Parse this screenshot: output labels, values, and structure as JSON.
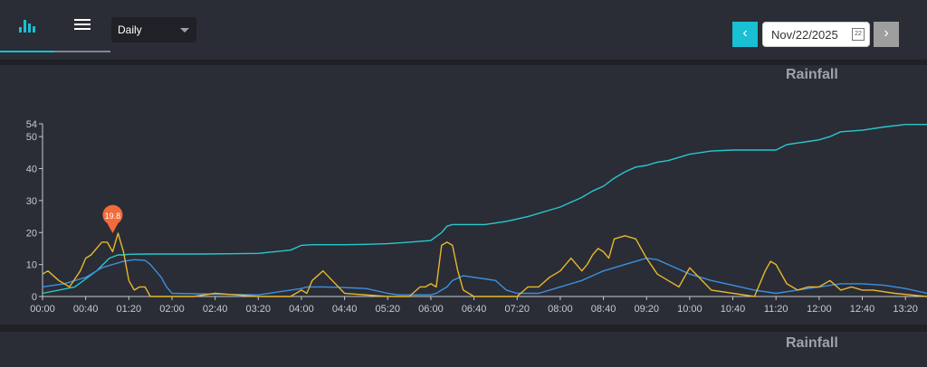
{
  "toolbar": {
    "chart_tab_icon": "bar-chart-icon",
    "list_tab_icon": "menu-icon",
    "period_select": "Daily",
    "prev_label": "‹",
    "date": "Nov/22/2025",
    "calendar_day": "22",
    "next_label": "›"
  },
  "panels": [
    {
      "title": "Rainfall"
    },
    {
      "title": "Rainfall"
    }
  ],
  "colors": {
    "accent": "#19bfd3",
    "cumulative": "#29c7cf",
    "blue": "#3d8fe0",
    "yellow": "#e7b62e",
    "marker": "#f26b3a"
  },
  "chart_data": {
    "type": "line",
    "title": "Rainfall",
    "ylim": [
      0,
      54
    ],
    "yticks": [
      0,
      10,
      20,
      30,
      40,
      50,
      54
    ],
    "xlim": [
      0,
      820
    ],
    "xticks": [
      "00:00",
      "00:40",
      "01:20",
      "02:00",
      "02:40",
      "03:20",
      "04:00",
      "04:40",
      "05:20",
      "06:00",
      "06:40",
      "07:20",
      "08:00",
      "08:40",
      "09:20",
      "10:00",
      "10:40",
      "11:20",
      "12:00",
      "12:40",
      "13:20"
    ],
    "x_tick_minutes": [
      0,
      40,
      80,
      120,
      160,
      200,
      240,
      280,
      320,
      360,
      400,
      440,
      480,
      520,
      560,
      600,
      640,
      680,
      720,
      760,
      800
    ],
    "marker": {
      "x_minutes": 65,
      "y": 19.8,
      "label": "19.8"
    },
    "series": [
      {
        "color": "#29c7cf",
        "x_minutes": [
          0,
          30,
          50,
          62,
          70,
          75,
          80,
          100,
          150,
          200,
          230,
          240,
          250,
          260,
          280,
          300,
          320,
          340,
          360,
          370,
          375,
          380,
          390,
          400,
          410,
          430,
          450,
          470,
          480,
          500,
          510,
          520,
          530,
          540,
          550,
          560,
          570,
          580,
          600,
          620,
          640,
          660,
          680,
          690,
          700,
          710,
          720,
          730,
          740,
          760,
          780,
          800,
          820
        ],
        "values": [
          1,
          3,
          8,
          12,
          13,
          13,
          13.2,
          13.3,
          13.3,
          13.5,
          14.5,
          16,
          16.2,
          16.2,
          16.2,
          16.3,
          16.5,
          17,
          17.5,
          20,
          22,
          22.5,
          22.5,
          22.5,
          22.5,
          23.5,
          25,
          27,
          28,
          31,
          33,
          34.5,
          37,
          39,
          40.5,
          41,
          42,
          42.5,
          44.5,
          45.5,
          45.8,
          45.8,
          45.8,
          47.5,
          48,
          48.5,
          49,
          50,
          51.5,
          52,
          53,
          53.8,
          53.8
        ]
      },
      {
        "color": "#3d8fe0",
        "x_minutes": [
          0,
          20,
          40,
          55,
          65,
          75,
          85,
          95,
          100,
          110,
          115,
          120,
          200,
          220,
          230,
          240,
          245,
          260,
          280,
          300,
          320,
          330,
          340,
          360,
          365,
          370,
          375,
          380,
          390,
          400,
          410,
          420,
          430,
          440,
          460,
          480,
          500,
          510,
          520,
          530,
          540,
          550,
          560,
          570,
          580,
          600,
          620,
          640,
          660,
          680,
          700,
          720,
          740,
          760,
          780,
          800,
          820
        ],
        "values": [
          3,
          4,
          6,
          9,
          10,
          11,
          11.5,
          11.3,
          10,
          6,
          3,
          1,
          0.5,
          1.5,
          2,
          2.5,
          3,
          3,
          2.8,
          2.5,
          1,
          0.5,
          0.5,
          0.5,
          1,
          2,
          3,
          5,
          6.5,
          6,
          5.5,
          5,
          2,
          1,
          1,
          3,
          5,
          6.5,
          8,
          9,
          10,
          11,
          12,
          11.5,
          10,
          7,
          5,
          3.5,
          2,
          1,
          2,
          3,
          4,
          4,
          3.5,
          2.5,
          1
        ]
      },
      {
        "color": "#e7b62e",
        "x_minutes": [
          0,
          5,
          15,
          25,
          35,
          40,
          45,
          55,
          60,
          65,
          70,
          75,
          80,
          85,
          90,
          95,
          100,
          120,
          140,
          160,
          200,
          230,
          240,
          245,
          250,
          260,
          280,
          320,
          340,
          350,
          355,
          360,
          365,
          370,
          375,
          380,
          385,
          390,
          400,
          440,
          450,
          460,
          470,
          480,
          490,
          500,
          505,
          510,
          515,
          520,
          525,
          530,
          540,
          550,
          560,
          570,
          580,
          590,
          600,
          620,
          660,
          670,
          675,
          680,
          690,
          700,
          710,
          720,
          730,
          740,
          750,
          760,
          770,
          790,
          820
        ],
        "values": [
          7,
          8,
          5,
          3,
          8,
          12,
          13,
          17,
          17,
          14,
          19.8,
          14,
          5,
          2,
          3,
          3,
          0,
          0,
          0,
          1,
          0,
          0,
          2,
          1,
          5,
          8,
          1,
          0,
          0,
          3,
          3,
          4,
          3,
          16,
          17,
          16,
          8,
          2,
          0,
          0,
          3,
          3,
          6,
          8,
          12,
          8,
          10,
          13,
          15,
          14,
          12,
          18,
          19,
          18,
          12,
          7,
          5,
          3,
          9,
          2,
          0,
          8,
          11,
          10,
          4,
          2,
          3,
          3,
          5,
          2,
          3,
          2,
          2,
          1,
          0
        ]
      }
    ]
  }
}
